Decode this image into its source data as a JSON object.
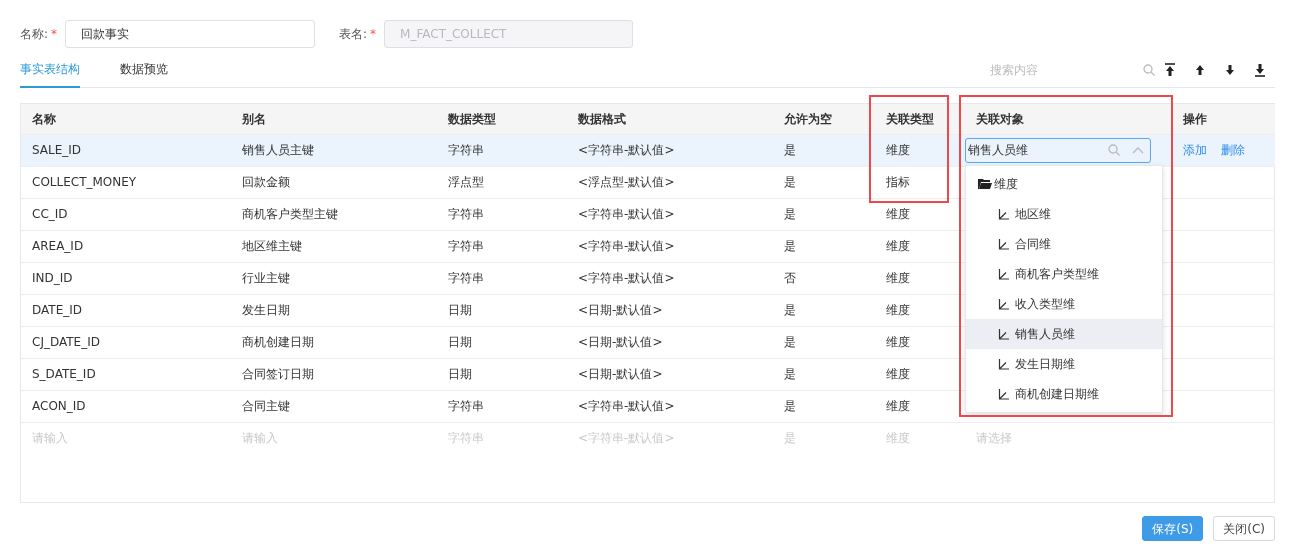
{
  "form": {
    "name_label": "名称:",
    "name_required": true,
    "name_required_mark": "*",
    "name_value": "回款事实",
    "table_label": "表名:",
    "table_required": true,
    "table_required_mark": "*",
    "table_value": "M_FACT_COLLECT",
    "table_disabled": true
  },
  "tabs": [
    {
      "label": "事实表结构",
      "selected": true
    },
    {
      "label": "数据预览",
      "selected": false
    }
  ],
  "search": {
    "placeholder": "搜索内容"
  },
  "toolbar": [
    {
      "kind": "top"
    },
    {
      "kind": "up"
    },
    {
      "kind": "down"
    },
    {
      "kind": "bottom"
    }
  ],
  "table": {
    "columns": [
      {
        "label": "名称",
        "highlighted": false
      },
      {
        "label": "别名",
        "highlighted": false
      },
      {
        "label": "数据类型",
        "highlighted": false
      },
      {
        "label": "数据格式",
        "highlighted": false
      },
      {
        "label": "允许为空",
        "highlighted": false
      },
      {
        "label": "关联类型",
        "highlighted": true
      },
      {
        "label": "关联对象",
        "highlighted": true
      },
      {
        "label": "操作",
        "highlighted": false
      }
    ],
    "rows": [
      {
        "kind": "data",
        "selected": true,
        "in_highlight": true,
        "cells": [
          "SALE_ID",
          "销售人员主键",
          "字符串",
          "<字符串-默认值>",
          "是",
          "维度"
        ],
        "object": {
          "value": "销售人员维",
          "expanded": true
        },
        "actions": [
          "添加",
          "删除"
        ]
      },
      {
        "kind": "data",
        "selected": false,
        "in_highlight": true,
        "cells": [
          "COLLECT_MONEY",
          "回款金额",
          "浮点型",
          "<浮点型-默认值>",
          "是",
          "指标"
        ]
      },
      {
        "kind": "data",
        "selected": false,
        "in_highlight": false,
        "cells": [
          "CC_ID",
          "商机客户类型主键",
          "字符串",
          "<字符串-默认值>",
          "是",
          "维度"
        ]
      },
      {
        "kind": "data",
        "selected": false,
        "in_highlight": false,
        "cells": [
          "AREA_ID",
          "地区维主键",
          "字符串",
          "<字符串-默认值>",
          "是",
          "维度"
        ]
      },
      {
        "kind": "data",
        "selected": false,
        "in_highlight": false,
        "cells": [
          "IND_ID",
          "行业主键",
          "字符串",
          "<字符串-默认值>",
          "否",
          "维度"
        ]
      },
      {
        "kind": "data",
        "selected": false,
        "in_highlight": false,
        "cells": [
          "DATE_ID",
          "发生日期",
          "日期",
          "<日期-默认值>",
          "是",
          "维度"
        ]
      },
      {
        "kind": "data",
        "selected": false,
        "in_highlight": false,
        "cells": [
          "CJ_DATE_ID",
          "商机创建日期",
          "日期",
          "<日期-默认值>",
          "是",
          "维度"
        ]
      },
      {
        "kind": "data",
        "selected": false,
        "in_highlight": false,
        "cells": [
          "S_DATE_ID",
          "合同签订日期",
          "日期",
          "<日期-默认值>",
          "是",
          "维度"
        ]
      },
      {
        "kind": "data",
        "selected": false,
        "in_highlight": false,
        "cells": [
          "ACON_ID",
          "合同主键",
          "字符串",
          "<字符串-默认值>",
          "是",
          "维度"
        ]
      },
      {
        "kind": "new",
        "selected": false,
        "in_highlight": false,
        "cells": [
          "请输入",
          "请输入",
          "字符串",
          "<字符串-默认值>",
          "是",
          "维度"
        ],
        "object": {
          "placeholder": "请选择"
        }
      }
    ]
  },
  "dropdown": {
    "tree": [
      {
        "label": "维度",
        "expanded": true,
        "children": [
          {
            "label": "地区维",
            "selected": false
          },
          {
            "label": "合同维",
            "selected": false
          },
          {
            "label": "商机客户类型维",
            "selected": false
          },
          {
            "label": "收入类型维",
            "selected": false
          },
          {
            "label": "销售人员维",
            "selected": true
          },
          {
            "label": "发生日期维",
            "selected": false
          },
          {
            "label": "商机创建日期维",
            "selected": false
          }
        ]
      }
    ]
  },
  "buttons": [
    {
      "label": "保存(S)",
      "kind": "primary"
    },
    {
      "label": "关闭(C)",
      "kind": "secondary"
    }
  ]
}
